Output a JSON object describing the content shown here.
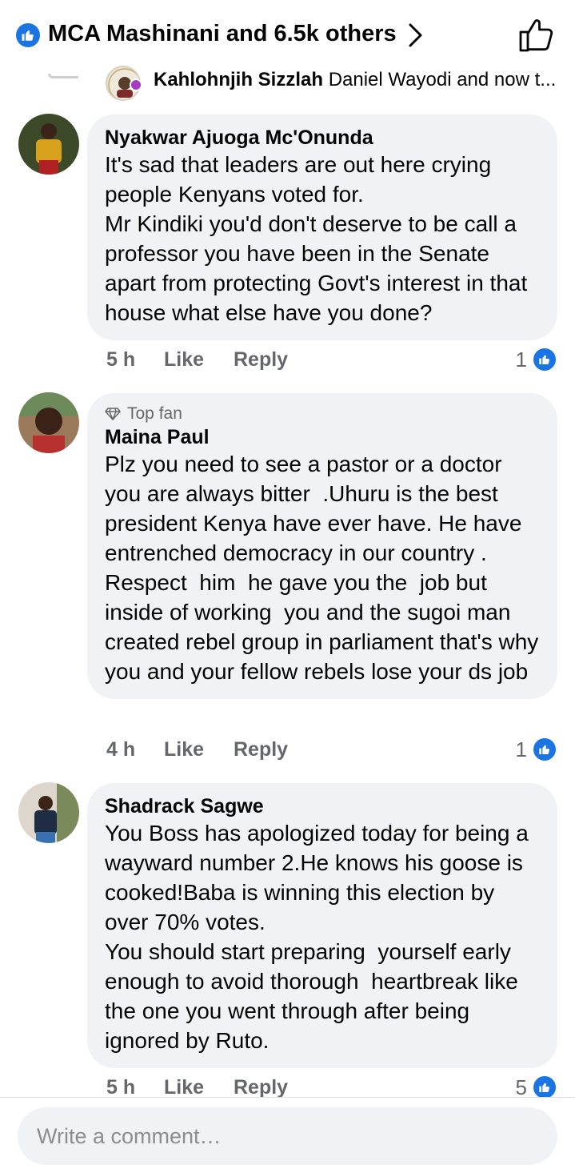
{
  "header": {
    "title": "MCA Mashinani and 6.5k others"
  },
  "previous_reply": {
    "author": "Kahlohnjih Sizzlah",
    "preview": "Daniel Wayodi and now t..."
  },
  "comments": [
    {
      "author": "Nyakwar Ajuoga Mc'Onunda",
      "badge": "",
      "text": "It's sad that leaders are out here crying people Kenyans voted for.\nMr Kindiki you'd don't deserve to be call a professor you have been in the Senate apart from protecting Govt's interest in that house what else have you done?",
      "time": "5 h",
      "like_label": "Like",
      "reply_label": "Reply",
      "reactions": "1"
    },
    {
      "author": "Maina Paul",
      "badge": "Top fan",
      "text": "Plz you need to see a pastor or a doctor you are always bitter  .Uhuru is the best president Kenya have ever have. He have entrenched democracy in our country . Respect  him  he gave you the  job but inside of working  you and the sugoi man created rebel group in parliament that's why you and your fellow rebels lose your ds job",
      "time": "4 h",
      "like_label": "Like",
      "reply_label": "Reply",
      "reactions": "1"
    },
    {
      "author": "Shadrack Sagwe",
      "badge": "",
      "text": "You Boss has apologized today for being a wayward number 2.He knows his goose is cooked!Baba is winning this election by over 70% votes.\nYou should start preparing  yourself early enough to avoid thorough  heartbreak like the one you went through after being ignored by Ruto.",
      "time": "5 h",
      "like_label": "Like",
      "reply_label": "Reply",
      "reactions": "5"
    }
  ],
  "composer": {
    "placeholder": "Write a comment…"
  },
  "colors": {
    "accent": "#1b74e4",
    "bubble": "#f0f2f5",
    "secondary_text": "#65676b"
  }
}
